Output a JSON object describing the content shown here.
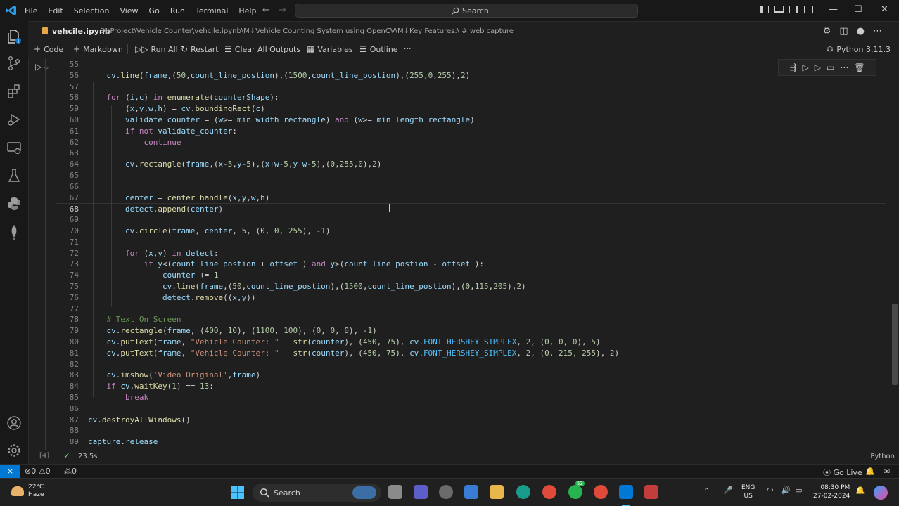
{
  "menu": [
    "File",
    "Edit",
    "Selection",
    "View",
    "Go",
    "Run",
    "Terminal",
    "Help"
  ],
  "search": {
    "label": "Search"
  },
  "tab": {
    "title": "vehcile.ipynb",
    "breadcrumbs": "D:\\Project\\Vehicle Counter\\vehcile.ipynb\\M↓Vehicle Counting System using OpenCV\\M↓Key Features:\\ # web capture"
  },
  "toolbar": {
    "code": "Code",
    "markdown": "Markdown",
    "run_all": "Run All",
    "restart": "Restart",
    "clear_outputs": "Clear All Outputs",
    "variables": "Variables",
    "outline": "Outline",
    "more": "···",
    "kernel": "Python 3.11.3"
  },
  "code_lines": [
    {
      "n": "55",
      "t": ""
    },
    {
      "n": "56",
      "t": "    cv.line(frame,(50,count_line_postion),(1500,count_line_postion),(255,0,255),2)"
    },
    {
      "n": "57",
      "t": ""
    },
    {
      "n": "58",
      "t": "    for (i,c) in enumerate(counterShape):"
    },
    {
      "n": "59",
      "t": "        (x,y,w,h) = cv.boundingRect(c)"
    },
    {
      "n": "60",
      "t": "        validate_counter = (w>= min_width_rectangle) and (w>= min_length_rectangle)"
    },
    {
      "n": "61",
      "t": "        if not validate_counter:"
    },
    {
      "n": "62",
      "t": "            continue"
    },
    {
      "n": "63",
      "t": ""
    },
    {
      "n": "64",
      "t": "        cv.rectangle(frame,(x-5,y-5),(x+w-5,y+w-5),(0,255,0),2)"
    },
    {
      "n": "65",
      "t": ""
    },
    {
      "n": "66",
      "t": ""
    },
    {
      "n": "67",
      "t": "        center = center_handle(x,y,w,h)"
    },
    {
      "n": "68",
      "t": "        detect.append(center)"
    },
    {
      "n": "69",
      "t": ""
    },
    {
      "n": "70",
      "t": "        cv.circle(frame, center, 5, (0, 0, 255), -1)"
    },
    {
      "n": "71",
      "t": ""
    },
    {
      "n": "72",
      "t": "        for (x,y) in detect:"
    },
    {
      "n": "73",
      "t": "            if y<(count_line_postion + offset ) and y>(count_line_postion - offset ):"
    },
    {
      "n": "74",
      "t": "                counter += 1"
    },
    {
      "n": "75",
      "t": "                cv.line(frame,(50,count_line_postion),(1500,count_line_postion),(0,115,205),2)"
    },
    {
      "n": "76",
      "t": "                detect.remove((x,y))"
    },
    {
      "n": "77",
      "t": ""
    },
    {
      "n": "78",
      "t": "    # Text On Screen"
    },
    {
      "n": "79",
      "t": "    cv.rectangle(frame, (400, 10), (1100, 100), (0, 0, 0), -1)"
    },
    {
      "n": "80",
      "t": "    cv.putText(frame, \"Vehicle Counter: \" + str(counter), (450, 75), cv.FONT_HERSHEY_SIMPLEX, 2, (0, 0, 0), 5)"
    },
    {
      "n": "81",
      "t": "    cv.putText(frame, \"Vehicle Counter: \" + str(counter), (450, 75), cv.FONT_HERSHEY_SIMPLEX, 2, (0, 215, 255), 2)"
    },
    {
      "n": "82",
      "t": ""
    },
    {
      "n": "83",
      "t": "    cv.imshow('Video Original',frame)"
    },
    {
      "n": "84",
      "t": "    if cv.waitKey(1) == 13:"
    },
    {
      "n": "85",
      "t": "        break"
    },
    {
      "n": "86",
      "t": ""
    },
    {
      "n": "87",
      "t": "cv.destroyAllWindows()"
    },
    {
      "n": "88",
      "t": ""
    },
    {
      "n": "89",
      "t": "capture.release"
    }
  ],
  "current_line": "68",
  "cell_footer": {
    "exec_count": "[4]",
    "time": "23.5s",
    "language": "Python"
  },
  "status": {
    "errors": "0",
    "warnings": "0",
    "ports": "0",
    "go_live": "Go Live"
  },
  "taskbar": {
    "temp": "22°C",
    "condition": "Haze",
    "search": "Search",
    "lang1": "ENG",
    "lang2": "US",
    "time": "08:30 PM",
    "date": "27-02-2024",
    "teams_badge": "53"
  },
  "colors": {
    "accent": "#0078d4",
    "bg": "#1f1f1f"
  }
}
